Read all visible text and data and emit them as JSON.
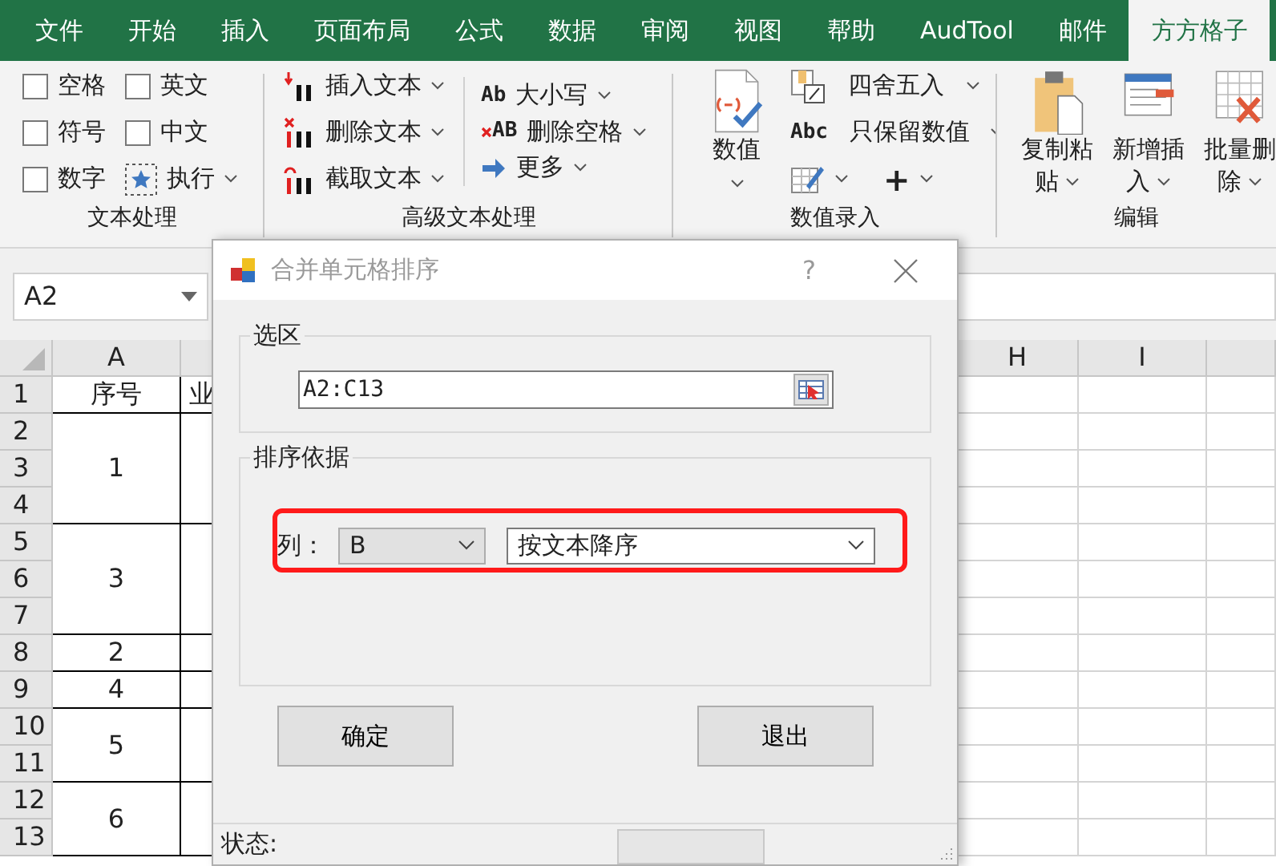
{
  "tabs": [
    {
      "label": "文件",
      "selected": false
    },
    {
      "label": "开始",
      "selected": false
    },
    {
      "label": "插入",
      "selected": false
    },
    {
      "label": "页面布局",
      "selected": false
    },
    {
      "label": "公式",
      "selected": false
    },
    {
      "label": "数据",
      "selected": false
    },
    {
      "label": "审阅",
      "selected": false
    },
    {
      "label": "视图",
      "selected": false
    },
    {
      "label": "帮助",
      "selected": false
    },
    {
      "label": "AudTool",
      "selected": false
    },
    {
      "label": "邮件",
      "selected": false
    },
    {
      "label": "方方格子",
      "selected": true
    }
  ],
  "ribbon": {
    "groups": [
      {
        "label": "文本处理",
        "columns": [
          [
            {
              "kind": "checkbox",
              "label": "空格",
              "checked": false
            },
            {
              "kind": "checkbox",
              "label": "符号",
              "checked": false
            },
            {
              "kind": "checkbox",
              "label": "数字",
              "checked": false
            }
          ],
          [
            {
              "kind": "checkbox",
              "label": "英文",
              "checked": false
            },
            {
              "kind": "checkbox",
              "label": "中文",
              "checked": false
            },
            {
              "kind": "menu",
              "label": "执行"
            }
          ]
        ]
      },
      {
        "label": "高级文本处理",
        "columns": [
          [
            {
              "kind": "menu",
              "label": "插入文本"
            },
            {
              "kind": "menu",
              "label": "删除文本"
            },
            {
              "kind": "menu",
              "label": "截取文本"
            }
          ],
          [
            {
              "kind": "menu",
              "glyph": "Ab",
              "label": "大小写"
            },
            {
              "kind": "menu",
              "glyph": "AB",
              "label": "删除空格"
            },
            {
              "kind": "menu",
              "label": "更多"
            }
          ]
        ]
      },
      {
        "label": "数值录入",
        "columns": [
          [
            {
              "kind": "large",
              "label": "数值"
            }
          ],
          [
            {
              "kind": "menu",
              "label": "四舍五入"
            },
            {
              "kind": "menu",
              "glyph": "Abc",
              "label": "只保留数值"
            },
            {
              "kind": "pair",
              "items": [
                {
                  "kind": "menu"
                },
                {
                  "kind": "menu",
                  "label": "+"
                }
              ]
            }
          ]
        ]
      },
      {
        "label": "编辑",
        "columns": [
          [
            {
              "kind": "large",
              "label": "复制粘贴"
            }
          ],
          [
            {
              "kind": "large",
              "label": "新增插入"
            }
          ],
          [
            {
              "kind": "large",
              "label": "批量删除"
            }
          ]
        ]
      }
    ]
  },
  "name_box": "A2",
  "sheet": {
    "columns": [
      "A",
      "H",
      "I"
    ],
    "rows": [
      {
        "number": "1",
        "a": "序号",
        "b": "业",
        "merged": false
      },
      {
        "number": "2",
        "a": "1",
        "merged": false
      },
      {
        "number": "3",
        "merged": true
      },
      {
        "number": "4",
        "merged": true
      },
      {
        "number": "5",
        "a": "3",
        "merged": false
      },
      {
        "number": "6",
        "merged": true
      },
      {
        "number": "7",
        "merged": true
      },
      {
        "number": "8",
        "a": "2",
        "merged": false
      },
      {
        "number": "9",
        "a": "4",
        "merged": false
      },
      {
        "number": "10",
        "a": "5",
        "merged": false
      },
      {
        "number": "11",
        "merged": true
      },
      {
        "number": "12",
        "a": "6",
        "merged": false
      },
      {
        "number": "13",
        "merged": true
      }
    ]
  },
  "dialog": {
    "title": "合并单元格排序",
    "help": "?",
    "selection": {
      "label": "选区",
      "value": "A2:C13"
    },
    "sort": {
      "label": "排序依据",
      "highlighted": true,
      "column_label": "列：",
      "column_value": "B",
      "order_value": "按文本降序"
    },
    "buttons": [
      "确定",
      "退出"
    ],
    "status_label": "状态:"
  }
}
